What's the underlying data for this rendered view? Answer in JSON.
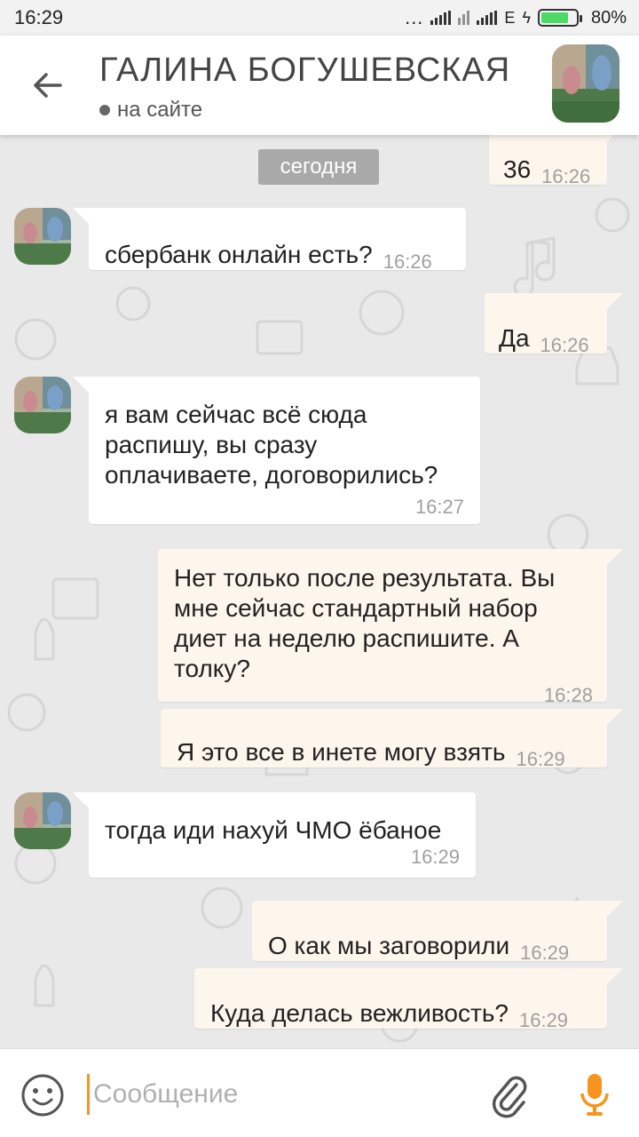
{
  "status_bar": {
    "time": "16:29",
    "dots": "...",
    "network": "E",
    "battery_level": 0.8,
    "battery_text": "80%"
  },
  "header": {
    "contact_name": "ГАЛИНА БОГУШЕВСКАЯ",
    "presence": "на сайте",
    "back_icon": "arrow-left-icon"
  },
  "date_separator": "сегодня",
  "messages": [
    {
      "dir": "out",
      "text": "36",
      "time": "16:26"
    },
    {
      "dir": "in",
      "text": "сбербанк онлайн есть?",
      "time": "16:26"
    },
    {
      "dir": "out",
      "text": "Да",
      "time": "16:26"
    },
    {
      "dir": "in",
      "text": "я вам сейчас всё сюда распишу, вы сразу оплачиваете, договорились?",
      "time": "16:27"
    },
    {
      "dir": "out",
      "text": "Нет только после результата. Вы мне сейчас стандартный набор диет на неделю распишите. А толку?",
      "time": "16:28"
    },
    {
      "dir": "out",
      "text": "Я это все в инете могу взять",
      "time": "16:29"
    },
    {
      "dir": "in",
      "text": "тогда иди нахуй ЧМО ёбаное",
      "time": "16:29"
    },
    {
      "dir": "out",
      "text": "О как мы заговорили",
      "time": "16:29"
    },
    {
      "dir": "out",
      "text": "Куда делась вежливость?",
      "time": "16:29"
    }
  ],
  "input": {
    "placeholder": "Сообщение",
    "value": ""
  },
  "colors": {
    "accent": "#f7931e",
    "incoming_bubble": "#ffffff",
    "outgoing_bubble": "#fdf6ec",
    "background": "#e9e9e9",
    "date_chip": "#a9a9a9"
  },
  "icons": [
    "arrow-left-icon",
    "smile-icon",
    "paperclip-icon",
    "microphone-icon",
    "signal-icon",
    "battery-icon"
  ]
}
